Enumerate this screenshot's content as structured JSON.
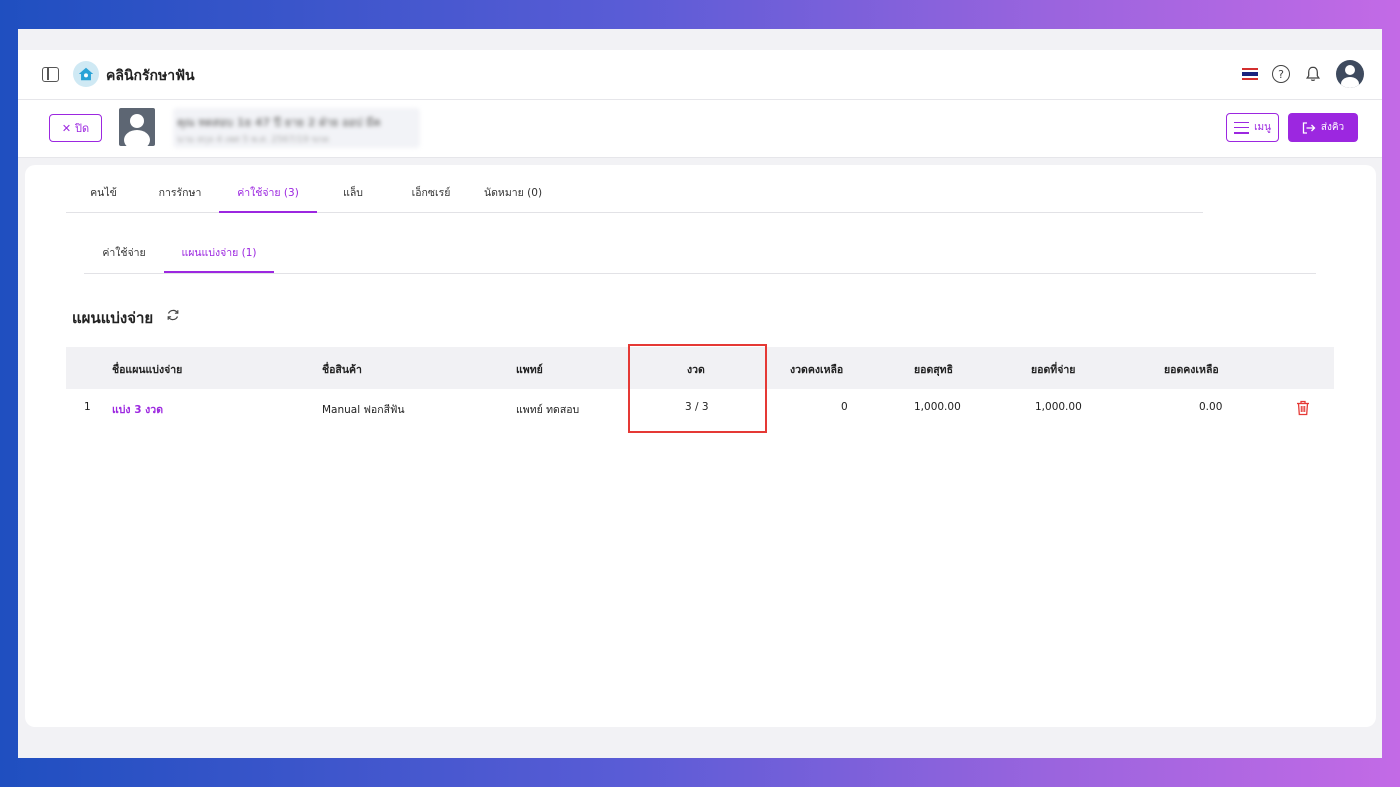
{
  "header": {
    "clinic_name": "คลินิกรักษาฟัน",
    "sidebar_toggle_icon": "sidebar-toggle-icon",
    "flag_icon": "thailand-flag-icon",
    "help_icon": "help-icon",
    "bell_icon": "bell-icon",
    "avatar_icon": "user-avatar-icon"
  },
  "patient_bar": {
    "close_label": "ปิด",
    "patient_name": "คุณ ทดสอบ 1ย 47 ปี ยาย 2 ฝ่าย ออป มีค",
    "patient_detail": "นาม สกุล 4 เพศ 5 พ.ศ. 2567/19 ขกต",
    "menu_label": "เมนู",
    "queue_label": "ส่งคิว"
  },
  "tabs": [
    {
      "label": "คนไข้",
      "active": false
    },
    {
      "label": "การรักษา",
      "active": false
    },
    {
      "label": "ค่าใช้จ่าย (3)",
      "active": true
    },
    {
      "label": "แล็บ",
      "active": false
    },
    {
      "label": "เอ็กซเรย์",
      "active": false
    },
    {
      "label": "นัดหมาย (0)",
      "active": false
    }
  ],
  "subtabs": [
    {
      "label": "ค่าใช้จ่าย",
      "active": false
    },
    {
      "label": "แผนแบ่งจ่าย (1)",
      "active": true
    }
  ],
  "section": {
    "title": "แผนแบ่งจ่าย"
  },
  "table": {
    "headers": [
      "ชื่อแผนแบ่งจ่าย",
      "ชื่อสินค้า",
      "แพทย์",
      "งวด",
      "งวดคงเหลือ",
      "ยอดสุทธิ",
      "ยอดที่จ่าย",
      "ยอดคงเหลือ"
    ],
    "rows": [
      {
        "index": "1",
        "plan_name": "แบ่ง 3 งวด",
        "product": "Manual ฟอกสีฟัน",
        "doctor": "แพทย์ ทดสอบ",
        "installments": "3 / 3",
        "remaining_installments": "0",
        "net_amount": "1,000.00",
        "paid_amount": "1,000.00",
        "balance": "0.00"
      }
    ]
  },
  "colors": {
    "accent": "#9c27e0",
    "highlight_box": "#e53935",
    "delete_icon": "#e53935"
  }
}
